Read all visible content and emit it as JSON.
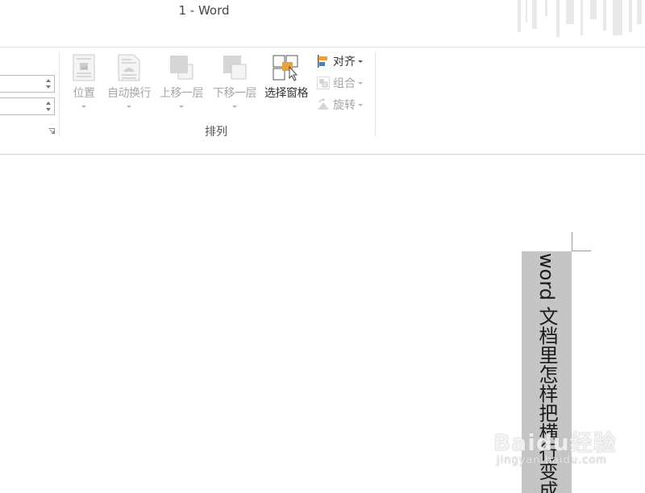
{
  "window": {
    "title": "1 - Word"
  },
  "ribbon": {
    "arrange_group": {
      "label": "排列",
      "buttons": [
        {
          "id": "position",
          "label": "位置",
          "enabled": false,
          "icon": "position-icon"
        },
        {
          "id": "wrap_text",
          "label": "自动换行",
          "enabled": false,
          "icon": "wrap-text-icon"
        },
        {
          "id": "bring_forward",
          "label": "上移一层",
          "enabled": false,
          "icon": "bring-forward-icon"
        },
        {
          "id": "send_backward",
          "label": "下移一层",
          "enabled": false,
          "icon": "send-backward-icon"
        },
        {
          "id": "selection_pane",
          "label": "选择窗格",
          "enabled": true,
          "icon": "selection-pane-icon"
        }
      ],
      "small_buttons": [
        {
          "id": "align",
          "label": "对齐",
          "enabled": true,
          "icon": "align-icon"
        },
        {
          "id": "group",
          "label": "组合",
          "enabled": false,
          "icon": "group-icon"
        },
        {
          "id": "rotate",
          "label": "旋转",
          "enabled": false,
          "icon": "rotate-icon"
        }
      ]
    }
  },
  "document": {
    "textbox_text": "word 文档里怎样把横行变成"
  },
  "watermark": {
    "line1": "Baidu经验",
    "line2": "jingyan.baidu.com"
  },
  "colors": {
    "textbox_fill": "#c5c5c5",
    "disabled_text": "#a6a6a6",
    "accent_orange": "#e8a33d"
  }
}
